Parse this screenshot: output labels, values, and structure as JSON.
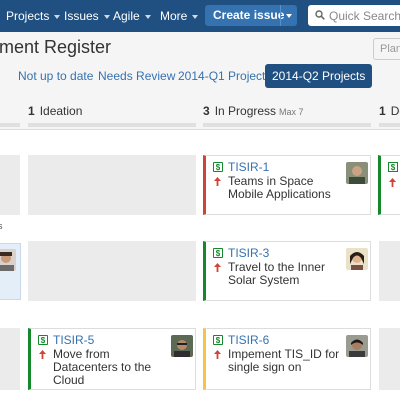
{
  "topnav": {
    "items": [
      "Projects",
      "Issues",
      "Agile",
      "More"
    ],
    "create_label": "Create issue",
    "search_placeholder": "Quick Search"
  },
  "header": {
    "title": "ment Register",
    "plan_label": "Plan",
    "filters": [
      "Not up to date",
      "Needs Review",
      "2014-Q1 Projects",
      "2014-Q2 Projects"
    ],
    "active_filter": "2014-Q2 Projects"
  },
  "columns": [
    {
      "count": "1",
      "name": "Ideation",
      "max": ""
    },
    {
      "count": "3",
      "name": "In Progress",
      "max": "Max 7"
    },
    {
      "count": "1",
      "name": "Do",
      "max": ""
    }
  ],
  "lane_label": "s",
  "cards": [
    {
      "key": "TISIR-1",
      "summary": "Teams in Space Mobile Applications",
      "type_icon": "$",
      "priority": "high",
      "color": "#d04437"
    },
    {
      "key": "TISIR-3",
      "summary": "Travel to the Inner Solar System",
      "type_icon": "$",
      "priority": "high",
      "color": "#14892c"
    },
    {
      "key": "TISIR-5",
      "summary": "Move from Datacenters to the Cloud",
      "type_icon": "$",
      "priority": "high",
      "color": "#14892c"
    },
    {
      "key": "TISIR-6",
      "summary": "Impement TIS_ID for single sign on",
      "type_icon": "$",
      "priority": "high",
      "color": "#f6c342"
    }
  ],
  "colors": {
    "nav": "#205081",
    "link": "#3572b0",
    "priority_up": "#d04437"
  }
}
